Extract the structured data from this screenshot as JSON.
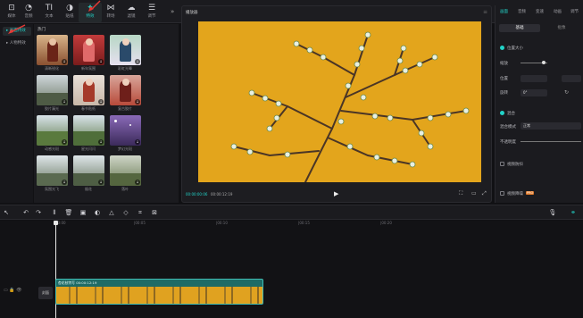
{
  "toolbar_top": {
    "items": [
      {
        "label": "媒体",
        "icon": "import-icon"
      },
      {
        "label": "音频",
        "icon": "audio-icon"
      },
      {
        "label": "文本",
        "icon": "text-icon"
      },
      {
        "label": "贴纸",
        "icon": "sticker-icon"
      },
      {
        "label": "特效",
        "icon": "effects-icon"
      },
      {
        "label": "转场",
        "icon": "transition-icon"
      },
      {
        "label": "滤镜",
        "icon": "filter-icon"
      },
      {
        "label": "调节",
        "icon": "adjust-icon"
      }
    ],
    "active_index": 4
  },
  "left_nav": {
    "items": [
      "画面特效",
      "人物特效"
    ],
    "active_index": 0
  },
  "effects": {
    "section_title": "热门",
    "thumbs": [
      {
        "label": "清晰锐化"
      },
      {
        "label": "新年氛围"
      },
      {
        "label": "彩虹光晕"
      },
      {
        "label": "胶片漏光"
      },
      {
        "label": "春节贴纸"
      },
      {
        "label": "复古胶片"
      },
      {
        "label": "动感光斑"
      },
      {
        "label": "星光闪闪"
      },
      {
        "label": "梦幻光斑"
      },
      {
        "label": "氛围光飞"
      },
      {
        "label": "烟花"
      },
      {
        "label": "落叶"
      }
    ]
  },
  "player": {
    "title": "播放器",
    "current_time": "00:00:00:06",
    "total_time": "00:00:12:19"
  },
  "properties": {
    "tabs": [
      "画面",
      "音频",
      "变速",
      "动画",
      "调节"
    ],
    "active_tab": 0,
    "subtabs": [
      "基础",
      "抠像"
    ],
    "position_size_label": "位置大小",
    "scale_label": "缩放",
    "position_label": "位置",
    "rotate_label": "旋转",
    "blend_label": "混合",
    "blend_mode_label": "混合模式",
    "blend_mode_value": "正常",
    "opacity_label": "不透明度",
    "stabilize_label": "视频防抖",
    "denoise_label": "视频降噪",
    "rotate_value": "0°",
    "pro_badge": "PRO"
  },
  "timeline": {
    "ticks": [
      "00:00",
      "|00:05",
      "|00:10",
      "|00:15",
      "|00:20"
    ],
    "track_label": "封面",
    "clip_title": "杏花枝特写  00:00:12:19"
  },
  "colors": {
    "accent": "#22d3c8",
    "clip": "#1e6b66"
  }
}
